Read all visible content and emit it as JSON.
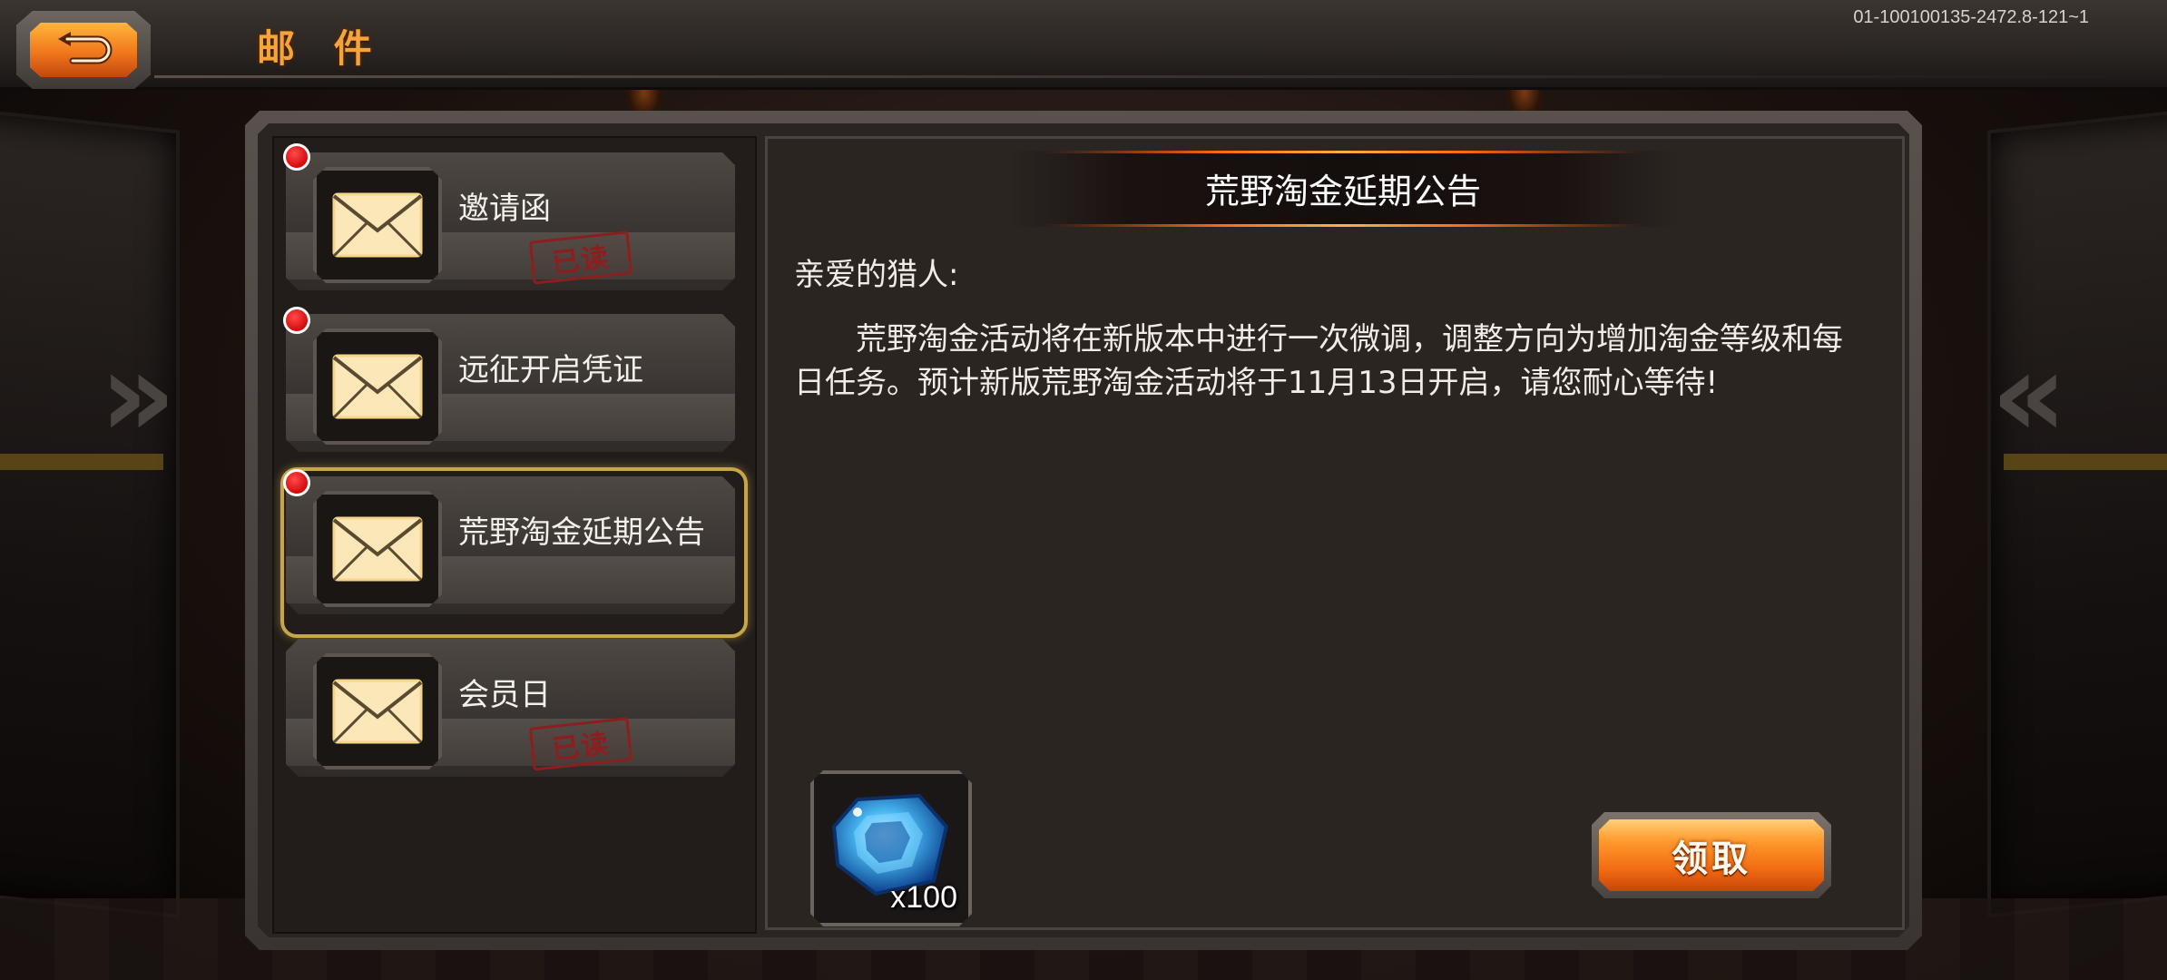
{
  "header": {
    "title": "邮 件",
    "version": "01-100100135-2472.8-121~1",
    "back_icon": "back-arrow-icon"
  },
  "mail_list": [
    {
      "title": "邀请函",
      "read": true,
      "read_label": "已读",
      "unread_dot": true
    },
    {
      "title": "远征开启凭证",
      "read": false,
      "unread_dot": true
    },
    {
      "title": "荒野淘金延期公告",
      "read": false,
      "unread_dot": true,
      "selected": true
    },
    {
      "title": "会员日",
      "read": true,
      "read_label": "已读",
      "unread_dot": false
    }
  ],
  "mail_detail": {
    "title": "荒野淘金延期公告",
    "greeting": "亲爱的猎人:",
    "body": "荒野淘金活动将在新版本中进行一次微调，调整方向为增加淘金等级和每日任务。预计新版荒野淘金活动将于11月13日开启，请您耐心等待!"
  },
  "reward": {
    "icon": "blue-gem-icon",
    "quantity": "x100"
  },
  "claim_button": {
    "label": "领取"
  },
  "colors": {
    "accent_orange": "#f0781c",
    "title_orange": "#f4a43a",
    "selected_border": "#c9a54a",
    "unread_dot": "#d40a0a",
    "read_stamp": "#8b1f1f"
  }
}
